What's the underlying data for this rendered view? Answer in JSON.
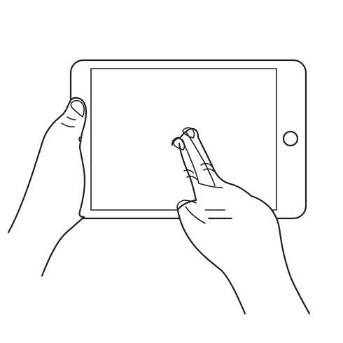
{
  "scene": {
    "illustration": "hands-holding-tablet-two-finger-gesture",
    "colors": {
      "background": "#ffffff",
      "line": "#1f1f1f"
    }
  }
}
